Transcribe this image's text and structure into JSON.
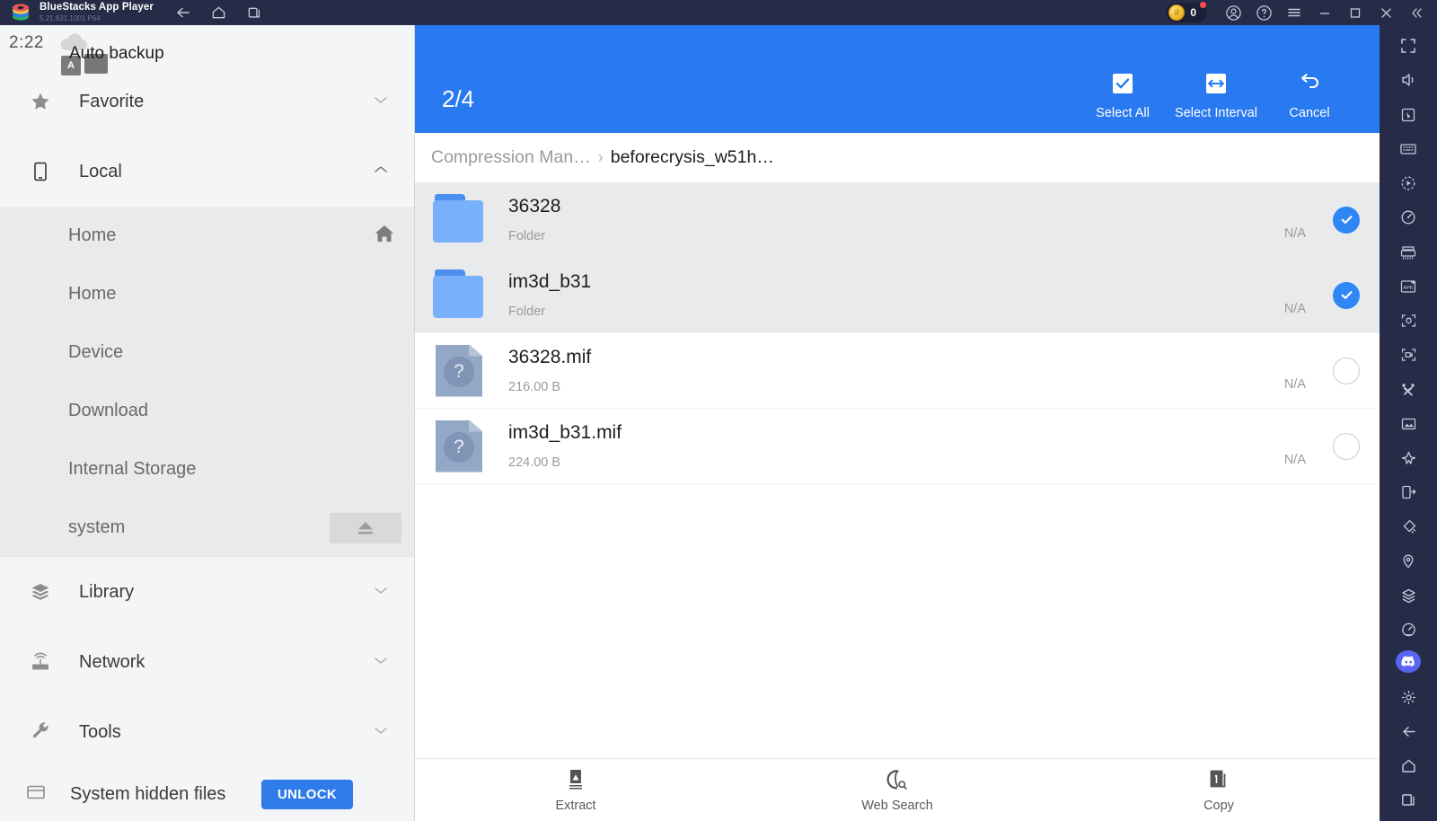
{
  "window": {
    "app_title": "BlueStacks App Player",
    "version": "5.21.631.1001  P64",
    "nav": [
      {
        "name": "back-icon",
        "label": "Back"
      },
      {
        "name": "home-icon",
        "label": "Home"
      },
      {
        "name": "recents-icon",
        "label": "Recents"
      }
    ],
    "coin_count": "0",
    "controls": [
      {
        "name": "account-icon",
        "label": "Account"
      },
      {
        "name": "help-icon",
        "label": "Help"
      },
      {
        "name": "menu-icon",
        "label": "Menu"
      },
      {
        "name": "minimize-icon",
        "label": "Minimize"
      },
      {
        "name": "maximize-icon",
        "label": "Maximize"
      },
      {
        "name": "close-icon",
        "label": "Close"
      },
      {
        "name": "collapse-icon",
        "label": "Collapse"
      }
    ]
  },
  "status_bar": {
    "time": "2:22",
    "auto_backup": "Auto backup",
    "ime_letter": "A"
  },
  "sidebar": {
    "groups": [
      {
        "label": "Favorite",
        "icon": "star-icon",
        "expanded": false,
        "children": []
      },
      {
        "label": "Local",
        "icon": "phone-icon",
        "expanded": true,
        "children": [
          {
            "label": "Home",
            "trailing": "home-icon"
          },
          {
            "label": "Home",
            "trailing": ""
          },
          {
            "label": "Device",
            "trailing": ""
          },
          {
            "label": "Download",
            "trailing": ""
          },
          {
            "label": "Internal Storage",
            "trailing": ""
          },
          {
            "label": "system",
            "trailing": "eject-icon"
          }
        ]
      },
      {
        "label": "Library",
        "icon": "layers-icon",
        "expanded": false,
        "children": []
      },
      {
        "label": "Network",
        "icon": "router-icon",
        "expanded": false,
        "children": []
      },
      {
        "label": "Tools",
        "icon": "wrench-icon",
        "expanded": false,
        "children": []
      }
    ],
    "bottom": {
      "label": "System hidden files",
      "button": "UNLOCK",
      "icon": "folder-hidden-icon"
    }
  },
  "main": {
    "selection_count": "2/4",
    "actions": [
      {
        "label": "Select All",
        "icon": "checkbox-checked-icon"
      },
      {
        "label": "Select Interval",
        "icon": "interval-arrows-icon"
      },
      {
        "label": "Cancel",
        "icon": "undo-arrow-icon"
      }
    ],
    "breadcrumb": [
      {
        "label": "Compression Man…",
        "active": false
      },
      {
        "label": "beforecrysis_w51h…",
        "active": true
      }
    ],
    "breadcrumb_separator": "›",
    "files": [
      {
        "name": "36328",
        "subtitle": "Folder",
        "size": "N/A",
        "type": "folder",
        "selected": true
      },
      {
        "name": "im3d_b31",
        "subtitle": "Folder",
        "size": "N/A",
        "type": "folder",
        "selected": true
      },
      {
        "name": "36328.mif",
        "subtitle": "216.00 B",
        "size": "N/A",
        "type": "file",
        "selected": false
      },
      {
        "name": "im3d_b31.mif",
        "subtitle": "224.00 B",
        "size": "N/A",
        "type": "file",
        "selected": false
      }
    ],
    "file_icon_glyph": "?",
    "bottom_actions": [
      {
        "label": "Extract",
        "icon": "extract-icon"
      },
      {
        "label": "Web Search",
        "icon": "web-search-icon"
      },
      {
        "label": "Copy",
        "icon": "copy-icon"
      }
    ]
  },
  "rail": {
    "items": [
      {
        "name": "fullscreen-icon"
      },
      {
        "name": "volume-icon"
      },
      {
        "name": "pointer-icon"
      },
      {
        "name": "keyboard-icon"
      },
      {
        "name": "play-record-icon"
      },
      {
        "name": "rotate-icon"
      },
      {
        "name": "gamepad-icon"
      },
      {
        "name": "install-apk-icon"
      },
      {
        "name": "screenshot-icon"
      },
      {
        "name": "screen-record-icon"
      },
      {
        "name": "macro-icon"
      },
      {
        "name": "media-manager-icon"
      },
      {
        "name": "eco-mode-icon"
      },
      {
        "name": "multi-instance-icon"
      },
      {
        "name": "shake-icon"
      },
      {
        "name": "location-icon"
      },
      {
        "name": "layers-rail-icon"
      },
      {
        "name": "performance-icon"
      }
    ],
    "pinned": [
      {
        "name": "discord-icon"
      },
      {
        "name": "settings-gear-icon"
      },
      {
        "name": "back-nav-icon"
      },
      {
        "name": "home-nav-icon"
      },
      {
        "name": "recents-nav-icon"
      }
    ]
  },
  "colors": {
    "accent_blue": "#2979f0",
    "check_blue": "#2f87f5",
    "chrome": "#262b47",
    "folder_blue": "#79b0fb",
    "file_slate": "#93a7c7"
  }
}
